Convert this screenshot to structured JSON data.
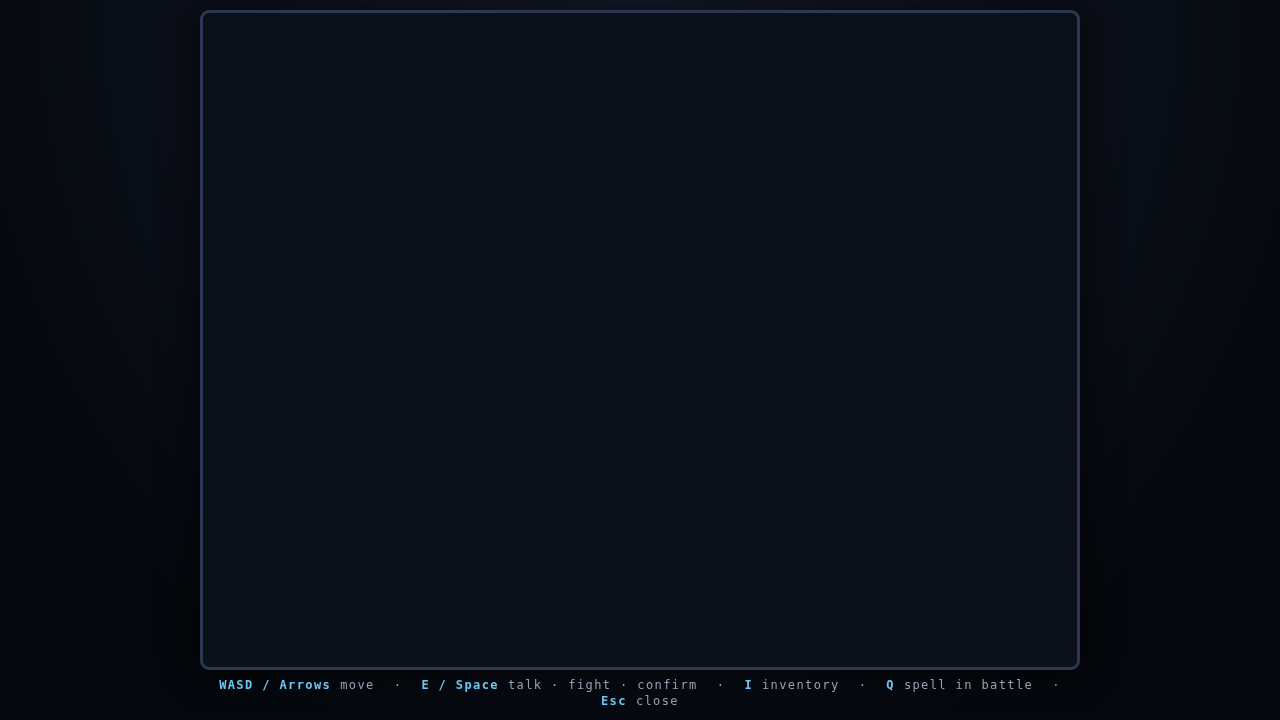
{
  "controls_hint": {
    "separator": "·",
    "hints": [
      {
        "keys": "WASD / Arrows",
        "action": "move"
      },
      {
        "keys": "E / Space",
        "action": "talk · fight · confirm"
      },
      {
        "keys": "I",
        "action": "inventory"
      },
      {
        "keys": "Q",
        "action": "spell in battle"
      },
      {
        "keys": "Esc",
        "action": "close"
      }
    ]
  }
}
